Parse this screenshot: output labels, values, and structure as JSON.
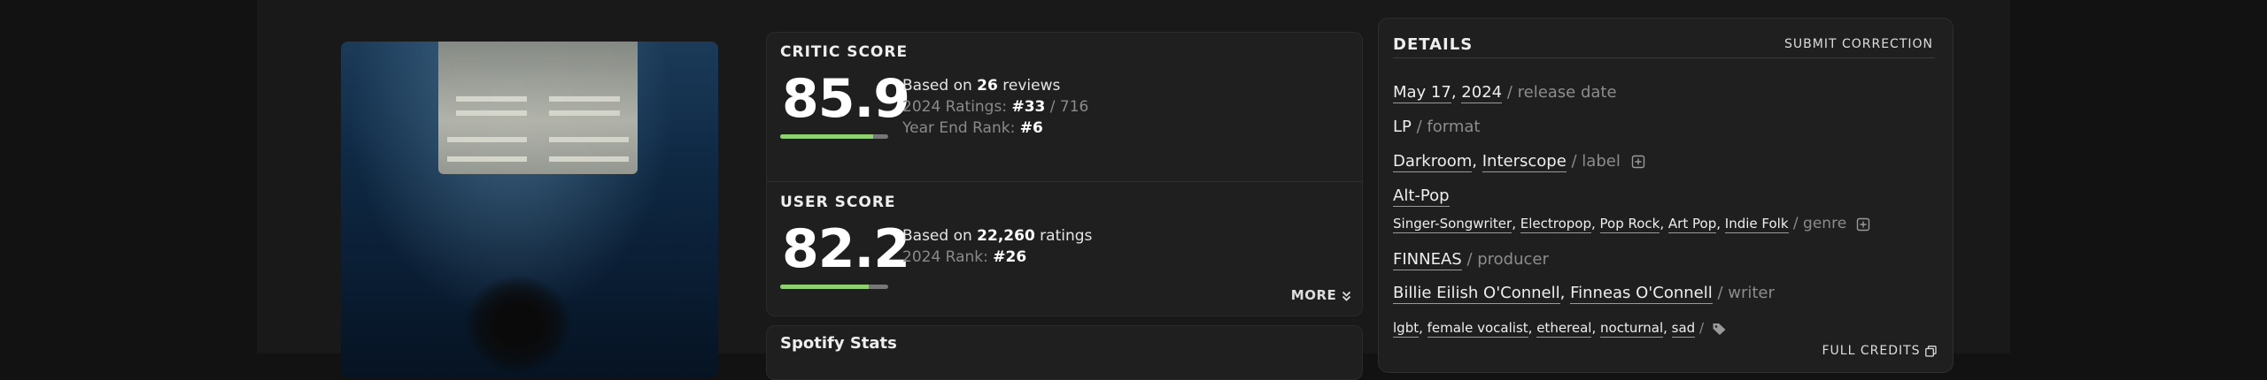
{
  "scores": {
    "critic": {
      "title": "CRITIC SCORE",
      "value": "85.9",
      "fill_percent": 86,
      "based_prefix": "Based on ",
      "reviews_count": "26",
      "reviews_suffix": " reviews",
      "ratings_label": "2024 Ratings: ",
      "ratings_rank": "#33",
      "ratings_total": " / 716",
      "year_end_label": "Year End Rank: ",
      "year_end_rank": "#6"
    },
    "user": {
      "title": "USER SCORE",
      "value": "82.2",
      "fill_percent": 82,
      "based_prefix": "Based on ",
      "ratings_count": "22,260",
      "ratings_suffix": " ratings",
      "rank_label": "2024 Rank: ",
      "rank": "#26"
    },
    "more_label": "MORE"
  },
  "spotify": {
    "title": "Spotify Stats"
  },
  "details": {
    "title": "DETAILS",
    "submit_label": "SUBMIT CORRECTION",
    "release_month_day": "May 17",
    "release_year": "2024",
    "release_suffix": " / release date",
    "format": "LP",
    "format_suffix": " / format",
    "labels": [
      "Darkroom",
      "Interscope"
    ],
    "label_suffix": " / label",
    "primary_genre": "Alt-Pop",
    "genres": [
      "Singer-Songwriter",
      "Electropop",
      "Pop Rock",
      "Art Pop",
      "Indie Folk"
    ],
    "genre_suffix": " / genre",
    "producer": "FINNEAS",
    "producer_suffix": " / producer",
    "writers": [
      "Billie Eilish O'Connell",
      "Finneas O'Connell"
    ],
    "writer_suffix": " / writer",
    "tags": [
      "lgbt",
      "female vocalist",
      "ethereal",
      "nocturnal",
      "sad"
    ],
    "tag_suffix": " /",
    "full_credits_label": "FULL CREDITS"
  },
  "colors": {
    "score_fill": "#8fd16e",
    "score_track": "#777777"
  },
  "icons": [
    "plus-box-icon",
    "tag-icon",
    "chevron-double-down-icon",
    "copy-icon"
  ]
}
